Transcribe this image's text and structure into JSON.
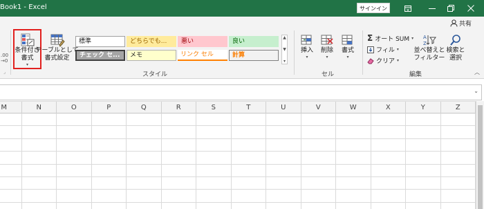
{
  "titlebar": {
    "title": "Book1  -  Excel",
    "signin": "サインイン",
    "share": "共有"
  },
  "ribbon": {
    "buttons": {
      "conditional_format": [
        "条件付き",
        "書式"
      ],
      "format_as_table": [
        "テーブルとして",
        "書式設定"
      ],
      "insert": "挿入",
      "delete": "削除",
      "format": "書式",
      "sort_filter": [
        "並べ替えと",
        "フィルター"
      ],
      "find_select": [
        "検索と",
        "選択"
      ]
    },
    "styles": {
      "row1": [
        "標準",
        "どちらでも...",
        "悪い",
        "良い"
      ],
      "row2": [
        "チェック セ...",
        "メモ",
        "リンク セル",
        "計算"
      ]
    },
    "editing": {
      "autosum": "オート SUM",
      "fill": "フィル",
      "clear": "クリア"
    },
    "groups": {
      "style": "スタイル",
      "cells": "セル",
      "editing": "編集"
    },
    "colors": {
      "bad_fill": "#ffc7ce",
      "good_fill": "#c6efce",
      "neutral_fill": "#ffeb9c",
      "check_fill": "#a5a5a5",
      "note_fill": "#ffffcc",
      "highlight": "#e1201e",
      "title_bar": "#217346"
    }
  },
  "grid": {
    "columns": [
      "M",
      "N",
      "O",
      "P",
      "Q",
      "R",
      "S",
      "T",
      "U",
      "V",
      "W",
      "X",
      "Y",
      "Z"
    ]
  }
}
